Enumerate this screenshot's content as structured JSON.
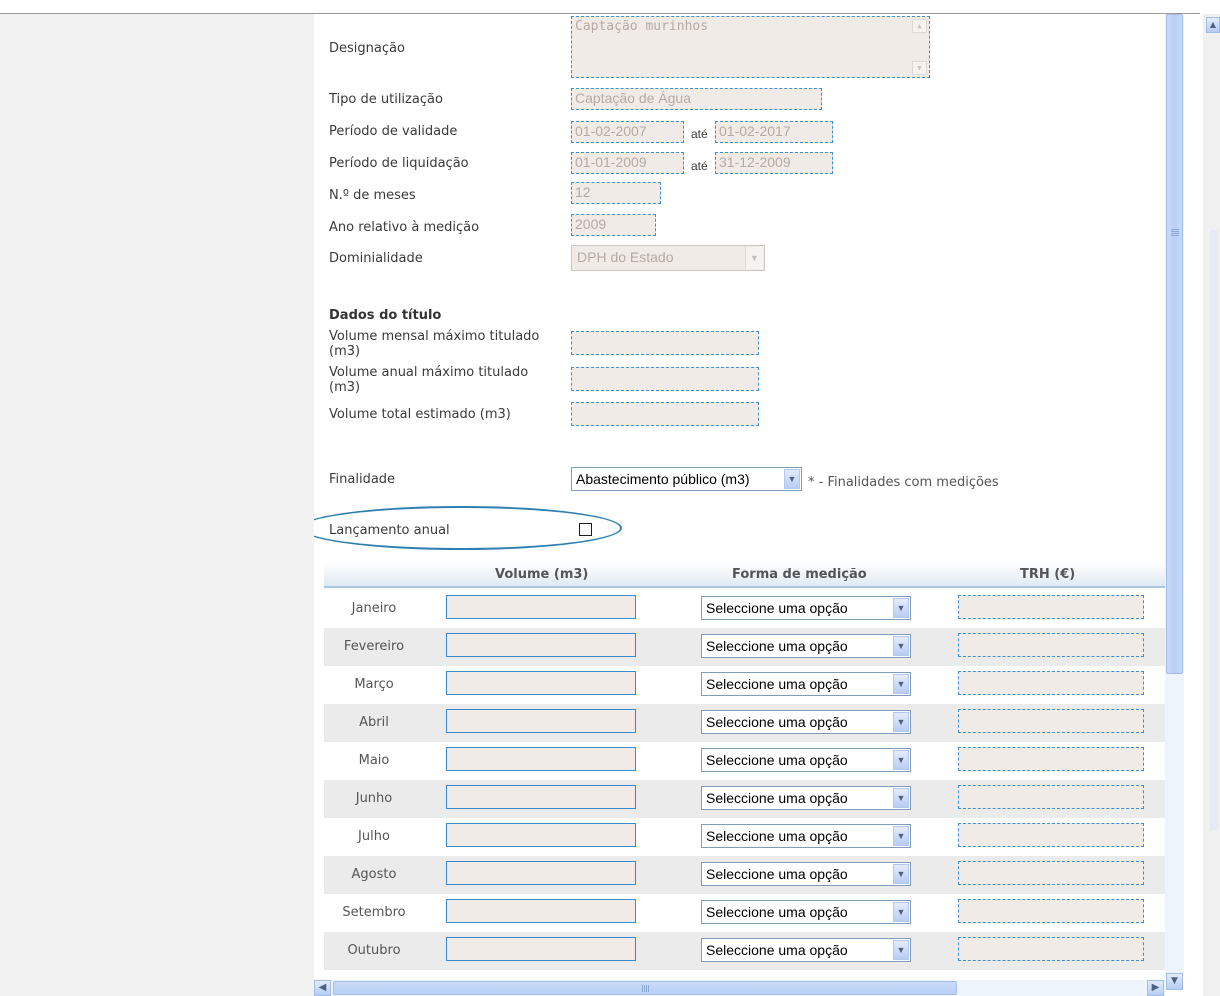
{
  "form": {
    "designacao": {
      "label": "Designação",
      "value": "Captação murinhos"
    },
    "tipo_utilizacao": {
      "label": "Tipo de utilização",
      "value": "Captação de Água"
    },
    "periodo_validade": {
      "label": "Período de validade",
      "from": "01-02-2007",
      "sep": "até",
      "to": "01-02-2017"
    },
    "periodo_liquidacao": {
      "label": "Período de liquidação",
      "from": "01-01-2009",
      "sep": "até",
      "to": "31-12-2009"
    },
    "num_meses": {
      "label": "N.º de meses",
      "value": "12"
    },
    "ano_medicao": {
      "label": "Ano relativo à medição",
      "value": "2009"
    },
    "dominialidade": {
      "label": "Dominialidade",
      "value": "DPH do Estado"
    }
  },
  "dados_titulo": {
    "title": "Dados do título",
    "volume_mensal": {
      "label_line1": "Volume mensal máximo titulado",
      "label_line2": "(m3)"
    },
    "volume_anual": {
      "label_line1": "Volume anual máximo titulado",
      "label_line2": "(m3)"
    },
    "volume_total": {
      "label": "Volume total estimado (m3)"
    }
  },
  "finalidade": {
    "label": "Finalidade",
    "value": "Abastecimento público (m3)",
    "hint": "* - Finalidades com medições"
  },
  "lancamento_anual": {
    "label": "Lançamento anual",
    "checked": false
  },
  "table": {
    "headers": {
      "volume": "Volume (m3)",
      "forma": "Forma de medição",
      "trh": "TRH (€)"
    },
    "select_placeholder": "Seleccione uma opção",
    "rows": [
      {
        "month": "Janeiro"
      },
      {
        "month": "Fevereiro"
      },
      {
        "month": "Março"
      },
      {
        "month": "Abril"
      },
      {
        "month": "Maio"
      },
      {
        "month": "Junho"
      },
      {
        "month": "Julho"
      },
      {
        "month": "Agosto"
      },
      {
        "month": "Setembro"
      },
      {
        "month": "Outubro"
      }
    ]
  },
  "icons": {
    "dropdown": "chevron-down-icon",
    "scroll_up": "arrow-up-icon",
    "scroll_down": "arrow-down-icon",
    "scroll_left": "arrow-left-icon",
    "scroll_right": "arrow-right-icon"
  },
  "colors": {
    "field_border": "#3f8fd8",
    "field_bg": "#f1ebe7",
    "disabled_text": "#b5aaa4",
    "highlight_ellipse": "#2f7fb0",
    "alt_row": "#ebebeb"
  }
}
